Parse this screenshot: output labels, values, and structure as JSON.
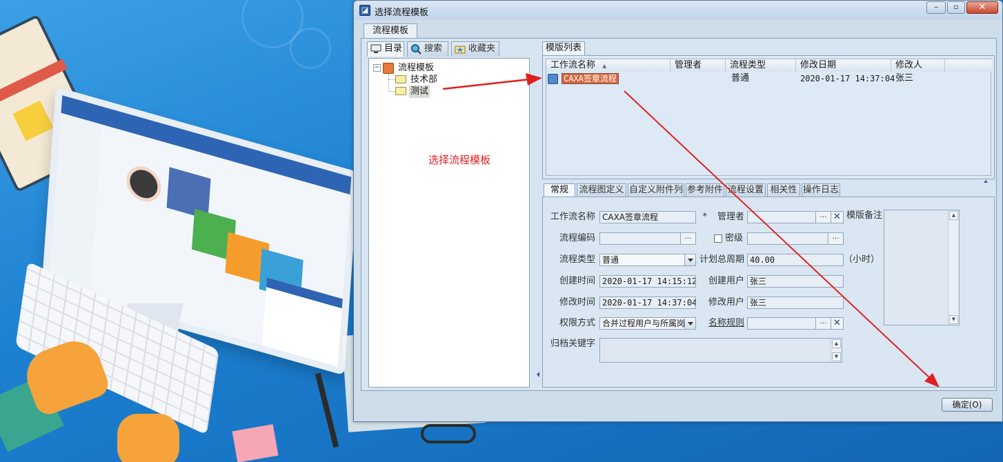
{
  "window": {
    "title": "选择流程模板",
    "outer_tab": "流程模板",
    "controls": {
      "minimize": "‒",
      "maximize": "▫",
      "close": "✕"
    }
  },
  "left_panel": {
    "tabs": [
      {
        "label": "目录",
        "icon": "monitor-icon"
      },
      {
        "label": "搜索",
        "icon": "search-icon"
      },
      {
        "label": "收藏夹",
        "icon": "folder-star-icon"
      }
    ],
    "tree": {
      "root": {
        "label": "流程模板",
        "expander": "−"
      },
      "children": [
        "技术部",
        "测试"
      ]
    },
    "annotation": "选择流程模板"
  },
  "template_list": {
    "tab": "模版列表",
    "columns": [
      "工作流名称",
      "管理者",
      "流程类型",
      "修改日期",
      "修改人"
    ],
    "sort_indicator": "▲",
    "rows": [
      {
        "name": "CAXA签章流程",
        "manager": "",
        "type": "普通",
        "modified": "2020-01-17 14:37:04",
        "modifier": "张三"
      }
    ]
  },
  "detail_tabs": [
    "常规",
    "流程图定义",
    "自定义附件列",
    "参考附件",
    "流程设置",
    "相关性",
    "操作日志"
  ],
  "form": {
    "workflow_name_label": "工作流名称",
    "workflow_name": "CAXA签章流程",
    "required_mark": "*",
    "manager_label": "管理者",
    "manager": "",
    "remark_label": "模版备注",
    "code_label": "流程编码",
    "code": "",
    "secret_label": "密级",
    "secret": "",
    "type_label": "流程类型",
    "type": "普通",
    "period_label": "计划总周期",
    "period": "40.00",
    "period_unit": "（小时）",
    "created_time_label": "创建时间",
    "created_time": "2020-01-17 14:15:12",
    "created_user_label": "创建用户",
    "created_user": "张三",
    "modified_time_label": "修改时间",
    "modified_time": "2020-01-17 14:37:04",
    "modified_user_label": "修改用户",
    "modified_user": "张三",
    "permission_label": "权限方式",
    "permission": "合并过程用户与所属岗",
    "naming_rule_label": "名称规则",
    "naming_rule": "",
    "archive_keyword_label": "归档关键字",
    "archive_keyword": "",
    "dots": "…",
    "clear": "✕"
  },
  "ok_button": "确定(O)",
  "colors": {
    "annotation": "#e02020",
    "selection_highlight": "#d4663e",
    "window_bg": "#cfdcea"
  }
}
